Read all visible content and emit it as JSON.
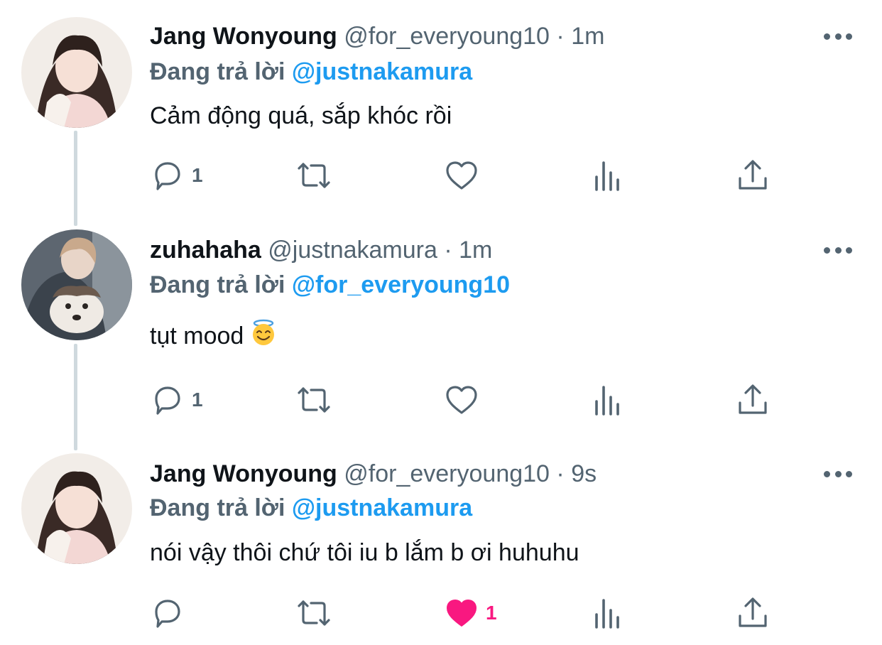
{
  "tweets": [
    {
      "name": "Jang Wonyoung",
      "handle": "@for_everyoung10",
      "time": "1m",
      "replying_prefix": "Đang trả lời",
      "replying_to": "@justnakamura",
      "text": "Cảm động quá, sắp khóc rồi",
      "reply_count": "1",
      "like_count": "",
      "liked": false
    },
    {
      "name": "zuhahaha",
      "handle": "@justnakamura",
      "time": "1m",
      "replying_prefix": "Đang trả lời",
      "replying_to": "@for_everyoung10",
      "text": "tụt mood",
      "reply_count": "1",
      "like_count": "",
      "liked": false
    },
    {
      "name": "Jang Wonyoung",
      "handle": "@for_everyoung10",
      "time": "9s",
      "replying_prefix": "Đang trả lời",
      "replying_to": "@justnakamura",
      "text": "nói vậy thôi chứ tôi iu b lắm b ơi huhuhu",
      "reply_count": "",
      "like_count": "1",
      "liked": true
    }
  ],
  "separator": "·",
  "colors": {
    "name": "#0f1419",
    "secondary": "#536471",
    "mention": "#1d9bf0",
    "like_active": "#f91880",
    "thread_line": "#cfd9de"
  },
  "icons": [
    "reply-icon",
    "retweet-icon",
    "like-icon",
    "analytics-icon",
    "share-icon",
    "more-icon"
  ]
}
